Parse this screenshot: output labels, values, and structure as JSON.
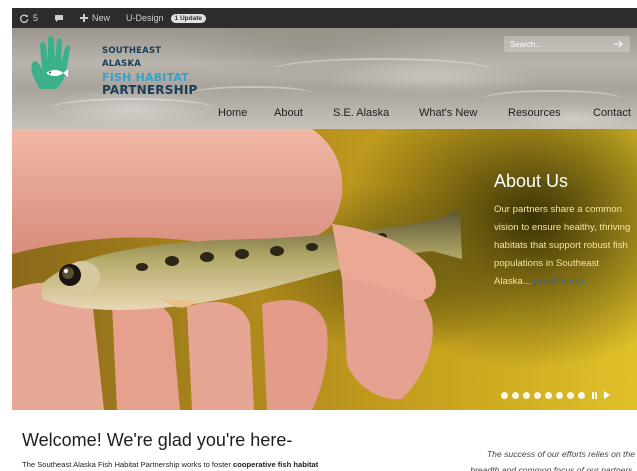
{
  "admin_bar": {
    "updates_count": "5",
    "new_label": "New",
    "theme_label": "U-Design",
    "update_badge": "1 Update"
  },
  "header": {
    "logo": {
      "line1": "SOUTHEAST ALASKA",
      "line2": "FISH HABITAT",
      "line3": "PARTNERSHIP",
      "colors": {
        "hand": "#3bb08a",
        "navy": "#1a3d5c",
        "blue": "#3aa0c8"
      }
    },
    "search": {
      "placeholder": "Search..."
    },
    "nav": [
      "Home",
      "About",
      "S.E. Alaska",
      "What's New",
      "Resources",
      "Contact"
    ]
  },
  "hero": {
    "title": "About Us",
    "text": "Our partners share a common vision to ensure healthy, thriving habitats that support robust fish populations in Southeast Alaska...",
    "read_more": "(read more)",
    "slide_count": 8
  },
  "welcome": {
    "heading": "Welcome! We're glad you're here-",
    "body_prefix": "The Southeast Alaska Fish Habitat Partnership works to foster ",
    "body_bold": "cooperative fish habitat",
    "quote_line1": "The success of our efforts relies on the",
    "quote_line2": "breadth and common focus of our partners."
  }
}
